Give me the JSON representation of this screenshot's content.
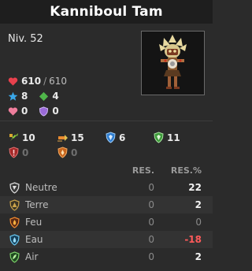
{
  "character": {
    "name": "Kanniboul Tam",
    "level": "Niv. 52"
  },
  "vitals": {
    "hp_current": "610",
    "hp_max": "610",
    "ap": "8",
    "mp": "4",
    "hp_shield": "0",
    "shield": "0"
  },
  "misc_stats": [
    {
      "icon": "damage-icon",
      "value": "10"
    },
    {
      "icon": "power-icon",
      "value": "15"
    },
    {
      "icon": "blue-shield-icon",
      "value": "6"
    },
    {
      "icon": "green-shield-icon",
      "value": "11"
    },
    {
      "icon": "red-shield-icon",
      "value": "0"
    },
    {
      "icon": "orange-shield-icon",
      "value": "0"
    }
  ],
  "resistances": {
    "header_res": "RES.",
    "header_pct": "RES.%",
    "rows": [
      {
        "element": "Neutre",
        "icon": "neutral-icon",
        "res": "0",
        "pct": "22"
      },
      {
        "element": "Terre",
        "icon": "earth-icon",
        "res": "0",
        "pct": "2"
      },
      {
        "element": "Feu",
        "icon": "fire-icon",
        "res": "0",
        "pct": "0"
      },
      {
        "element": "Eau",
        "icon": "water-icon",
        "res": "0",
        "pct": "-18"
      },
      {
        "element": "Air",
        "icon": "air-icon",
        "res": "0",
        "pct": "2"
      }
    ]
  },
  "colors": {
    "background": "#2b2b2b",
    "title_bar": "#1e1e1e",
    "negative": "#ff5a5a"
  }
}
